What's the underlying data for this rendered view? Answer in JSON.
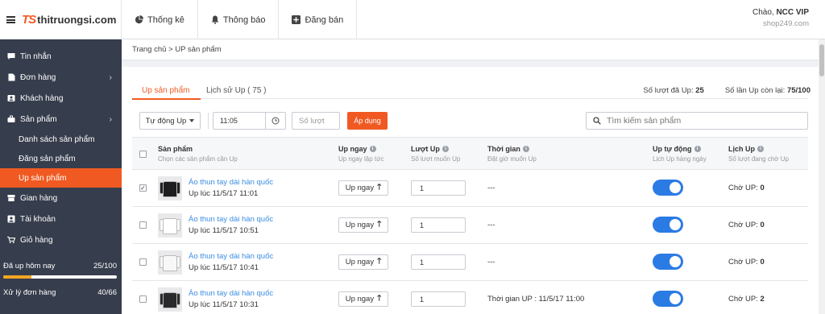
{
  "brand": {
    "mark": "TS",
    "name": "thitruongsi.com"
  },
  "topnav": [
    {
      "label": "Thống kê",
      "icon": "pie-chart-icon"
    },
    {
      "label": "Thông báo",
      "icon": "bell-icon"
    },
    {
      "label": "Đăng bán",
      "icon": "plus-square-icon"
    }
  ],
  "user": {
    "greeting": "Chào,",
    "name": "NCC VIP",
    "shop": "shop249.com"
  },
  "sidebar": {
    "items": [
      {
        "label": "Tin nhắn",
        "icon": "chat-icon"
      },
      {
        "label": "Đơn hàng",
        "icon": "document-icon",
        "caret": "›"
      },
      {
        "label": "Khách hàng",
        "icon": "contact-card-icon"
      },
      {
        "label": "Sản phẩm",
        "icon": "briefcase-icon",
        "caret": "›"
      }
    ],
    "sub_items": [
      {
        "label": "Danh sách sản phẩm"
      },
      {
        "label": "Đăng sản phẩm"
      },
      {
        "label": "Up sản phẩm"
      }
    ],
    "items_after": [
      {
        "label": "Gian hàng",
        "icon": "store-icon"
      },
      {
        "label": "Tài khoản",
        "icon": "user-card-icon"
      },
      {
        "label": "Giỏ hàng",
        "icon": "cart-icon"
      }
    ],
    "stats": [
      {
        "label": "Đã up hôm nay",
        "value": "25/100",
        "progress": 0.25
      },
      {
        "label": "Xử lý đơn hàng",
        "value": "40/66",
        "progress": 0.61
      }
    ]
  },
  "breadcrumb": "Trang chủ > UP sản phẩm",
  "tabs": [
    {
      "label": "Up sản phẩm",
      "active": true
    },
    {
      "label": "Lịch sử Up ( 75 )",
      "active": false
    }
  ],
  "counts": {
    "used_label": "Số lượt đã Up:",
    "used_value": "25",
    "left_label": "Số lần Up còn lại:",
    "left_value": "75/100"
  },
  "toolbar": {
    "mode": "Tự động Up",
    "time_value": "11:05",
    "count_placeholder": "Số lượt",
    "apply_label": "Áp dụng",
    "search_placeholder": "Tìm kiếm sản phẩm"
  },
  "columns": [
    {
      "title": "Sản phẩm",
      "sub": "Chọn các sản phẩm cần Up",
      "info": false
    },
    {
      "title": "Up ngay",
      "sub": "Up ngay lập tức",
      "info": true
    },
    {
      "title": "Lượt Up",
      "sub": "Số lượt muốn Up",
      "info": true
    },
    {
      "title": "Thời gian",
      "sub": "Đặt giờ muốn Up",
      "info": true
    },
    {
      "title": "Up tự động",
      "sub": "Lịch Up hàng ngày",
      "info": true
    },
    {
      "title": "Lịch Up",
      "sub": "Số lượt đang chờ Up",
      "info": true
    }
  ],
  "rows": [
    {
      "checked": true,
      "name": "Áo thun tay dài hàn quốc",
      "up_time": "Up lúc 11/5/17 11:01",
      "up_now": "Up ngay",
      "qty": "1",
      "schedule": "---",
      "auto": true,
      "wait_label": "Chờ UP:",
      "wait": "0",
      "shirt": "#1d1d1f"
    },
    {
      "checked": false,
      "name": "Áo thun tay dài hàn quốc",
      "up_time": "Up lúc 11/5/17 10:51",
      "up_now": "Up ngay",
      "qty": "1",
      "schedule": "---",
      "auto": true,
      "wait_label": "Chờ UP:",
      "wait": "0",
      "shirt": "#ffffff"
    },
    {
      "checked": false,
      "name": "Áo thun tay dài hàn quốc",
      "up_time": "Up lúc 11/5/17 10:41",
      "up_now": "Up ngay",
      "qty": "1",
      "schedule": "---",
      "auto": true,
      "wait_label": "Chờ UP:",
      "wait": "0",
      "shirt": "#f7f7f7"
    },
    {
      "checked": false,
      "name": "Áo thun tay dài hàn quốc",
      "up_time": "Up lúc 11/5/17 10:31",
      "up_now": "Up ngay",
      "qty": "1",
      "schedule": "Thời gian UP : 11/5/17 11:00",
      "auto": true,
      "wait_label": "Chờ UP:",
      "wait": "2",
      "shirt": "#2a2a2c"
    }
  ],
  "colors": {
    "accent": "#f05a22",
    "sidebar_bg": "#363d4c",
    "toggle": "#2a7be4",
    "link": "#3b8de0"
  }
}
